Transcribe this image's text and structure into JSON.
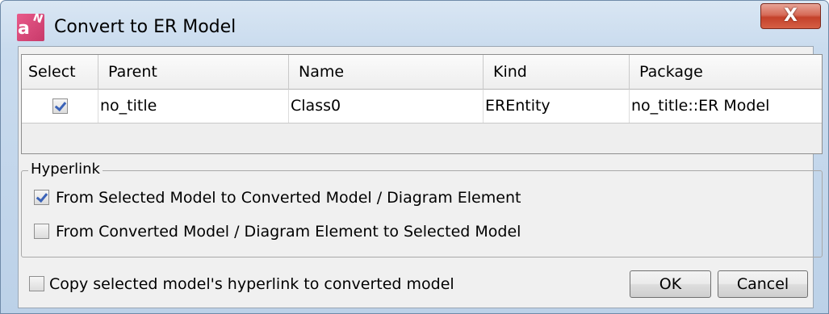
{
  "window": {
    "title": "Convert to ER Model",
    "close_label": "X"
  },
  "table": {
    "columns": [
      "Select",
      "Parent",
      "Name",
      "Kind",
      "Package"
    ],
    "rows": [
      {
        "selected": true,
        "parent": "no_title",
        "name": "Class0",
        "kind": "EREntity",
        "package": "no_title::ER Model"
      }
    ]
  },
  "hyperlink": {
    "group_label": "Hyperlink",
    "options": [
      {
        "label": "From Selected Model to Converted Model / Diagram Element",
        "checked": true
      },
      {
        "label": "From Converted Model / Diagram Element to Selected Model",
        "checked": false
      }
    ]
  },
  "copy_hyperlink": {
    "label": "Copy selected model's hyperlink to converted model",
    "checked": false
  },
  "buttons": {
    "ok": "OK",
    "cancel": "Cancel"
  },
  "colors": {
    "titlebar": "#c9dbee",
    "close_button": "#c4412a",
    "check_mark": "#3b63b8"
  }
}
